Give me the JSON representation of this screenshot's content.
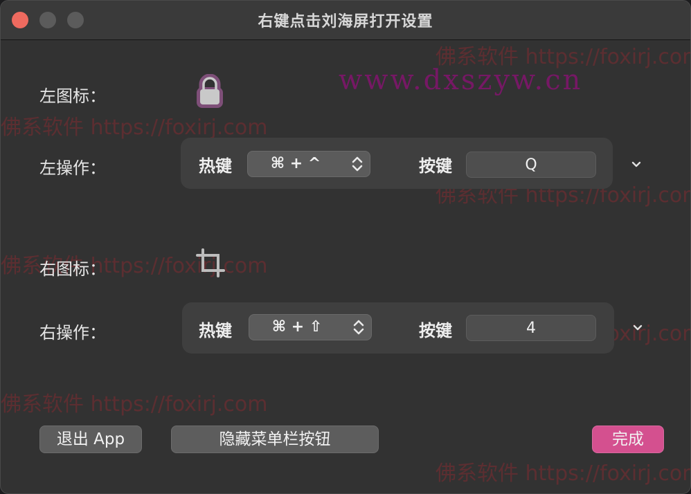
{
  "window": {
    "title": "右键点击刘海屏打开设置"
  },
  "left": {
    "icon_label": "左图标：",
    "icon": "lock-icon",
    "action_label": "左操作：",
    "hotkey_label": "热键",
    "hotkey_value": "⌘ + ^",
    "key_label": "按键",
    "key_value": "Q"
  },
  "right": {
    "icon_label": "右图标：",
    "icon": "crop-icon",
    "action_label": "右操作：",
    "hotkey_label": "热键",
    "hotkey_value": "⌘ + ⇧",
    "key_label": "按键",
    "key_value": "4"
  },
  "buttons": {
    "quit": "退出 App",
    "hide_menubar": "隐藏菜单栏按钮",
    "done": "完成"
  },
  "watermarks": {
    "foxirj": "佛系软件 https://foxirj.com",
    "site": "www.dxszyw.cn"
  },
  "colors": {
    "accent": "#d4508f",
    "close": "#ee6a5f",
    "lock_fill": "#7e4f78"
  }
}
